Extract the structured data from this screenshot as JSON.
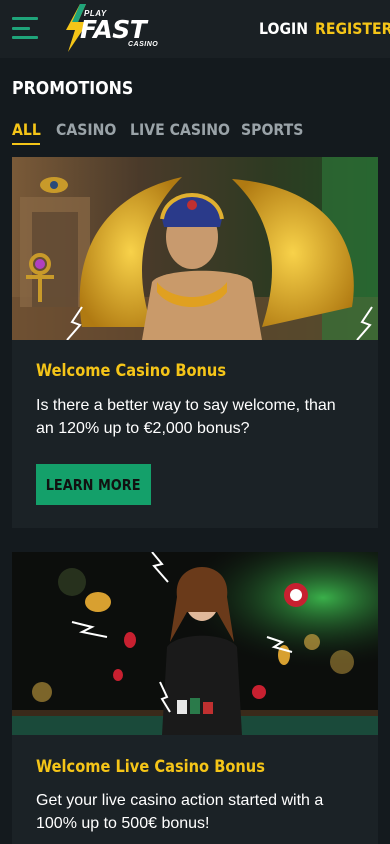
{
  "header": {
    "logo": {
      "play": "PLAY",
      "fast": "FAST",
      "casino": "CASINO"
    },
    "login_label": "LOGIN",
    "register_label": "REGISTER"
  },
  "page": {
    "title": "PROMOTIONS"
  },
  "tabs": [
    {
      "label": "ALL",
      "active": true
    },
    {
      "label": "CASINO",
      "active": false
    },
    {
      "label": "LIVE CASINO",
      "active": false
    },
    {
      "label": "SPORTS",
      "active": false
    }
  ],
  "promotions": [
    {
      "title": "Welcome Casino Bonus",
      "description": "Is there a better way to say welcome, than an 120% up to €2,000 bonus?",
      "button_label": "LEARN MORE"
    },
    {
      "title": "Welcome Live Casino Bonus",
      "description": "Get your live casino action started with a 100% up to 500€ bonus!"
    }
  ],
  "colors": {
    "accent_yellow": "#f5c518",
    "accent_green": "#14a06a",
    "background": "#141a1e",
    "card": "#1b2226"
  }
}
